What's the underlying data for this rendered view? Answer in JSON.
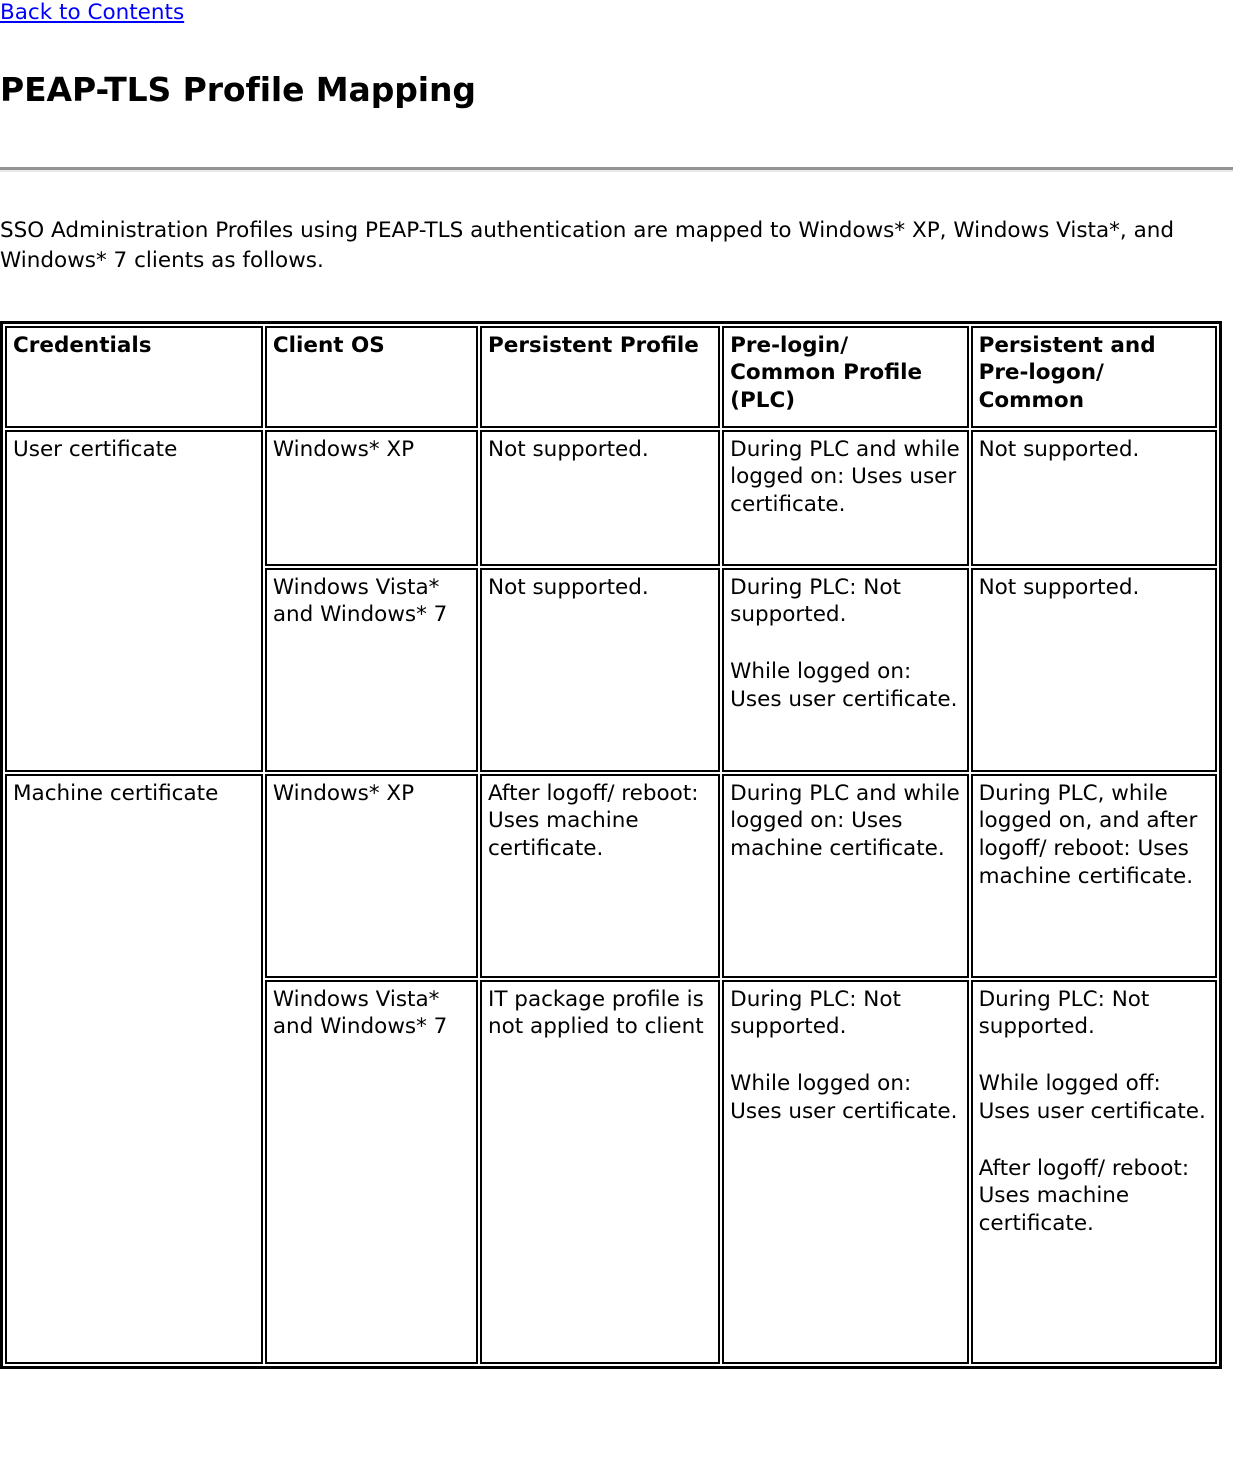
{
  "nav": {
    "back_link": "Back to Contents"
  },
  "header": {
    "title": "PEAP-TLS Profile Mapping"
  },
  "intro": {
    "paragraph": "SSO Administration Profiles using PEAP-TLS authentication are mapped to Windows* XP, Windows Vista*, and Windows* 7 clients as follows."
  },
  "table": {
    "columns": [
      "Credentials",
      "Client OS",
      "Persistent Profile",
      "Pre-login/ Common Profile (PLC)",
      "Persistent and Pre-logon/ Common"
    ],
    "rows": [
      {
        "credentials": "User certificate",
        "client_os": "Windows* XP",
        "persistent_profile": [
          "Not supported."
        ],
        "plc": [
          "During PLC and while logged on: Uses user certificate."
        ],
        "persistent_prelogon": [
          "Not supported."
        ]
      },
      {
        "credentials": "",
        "client_os": "Windows Vista* and Windows* 7",
        "persistent_profile": [
          "Not supported."
        ],
        "plc": [
          "During PLC: Not supported.",
          "While logged on: Uses user certificate."
        ],
        "persistent_prelogon": [
          "Not supported."
        ]
      },
      {
        "credentials": "Machine certificate",
        "client_os": "Windows* XP",
        "persistent_profile": [
          "After logoff/ reboot: Uses machine certificate."
        ],
        "plc": [
          "During PLC and while logged on: Uses machine certificate."
        ],
        "persistent_prelogon": [
          "During PLC, while logged on, and after logoff/ reboot: Uses machine certificate."
        ]
      },
      {
        "credentials": "",
        "client_os": "Windows Vista* and Windows* 7",
        "persistent_profile": [
          "IT package profile is not applied to client"
        ],
        "plc": [
          "During PLC: Not supported.",
          "While logged on: Uses user certificate."
        ],
        "persistent_prelogon": [
          "During PLC: Not supported.",
          "While logged off: Uses user certificate.",
          "After logoff/ reboot: Uses machine certificate."
        ]
      }
    ]
  }
}
